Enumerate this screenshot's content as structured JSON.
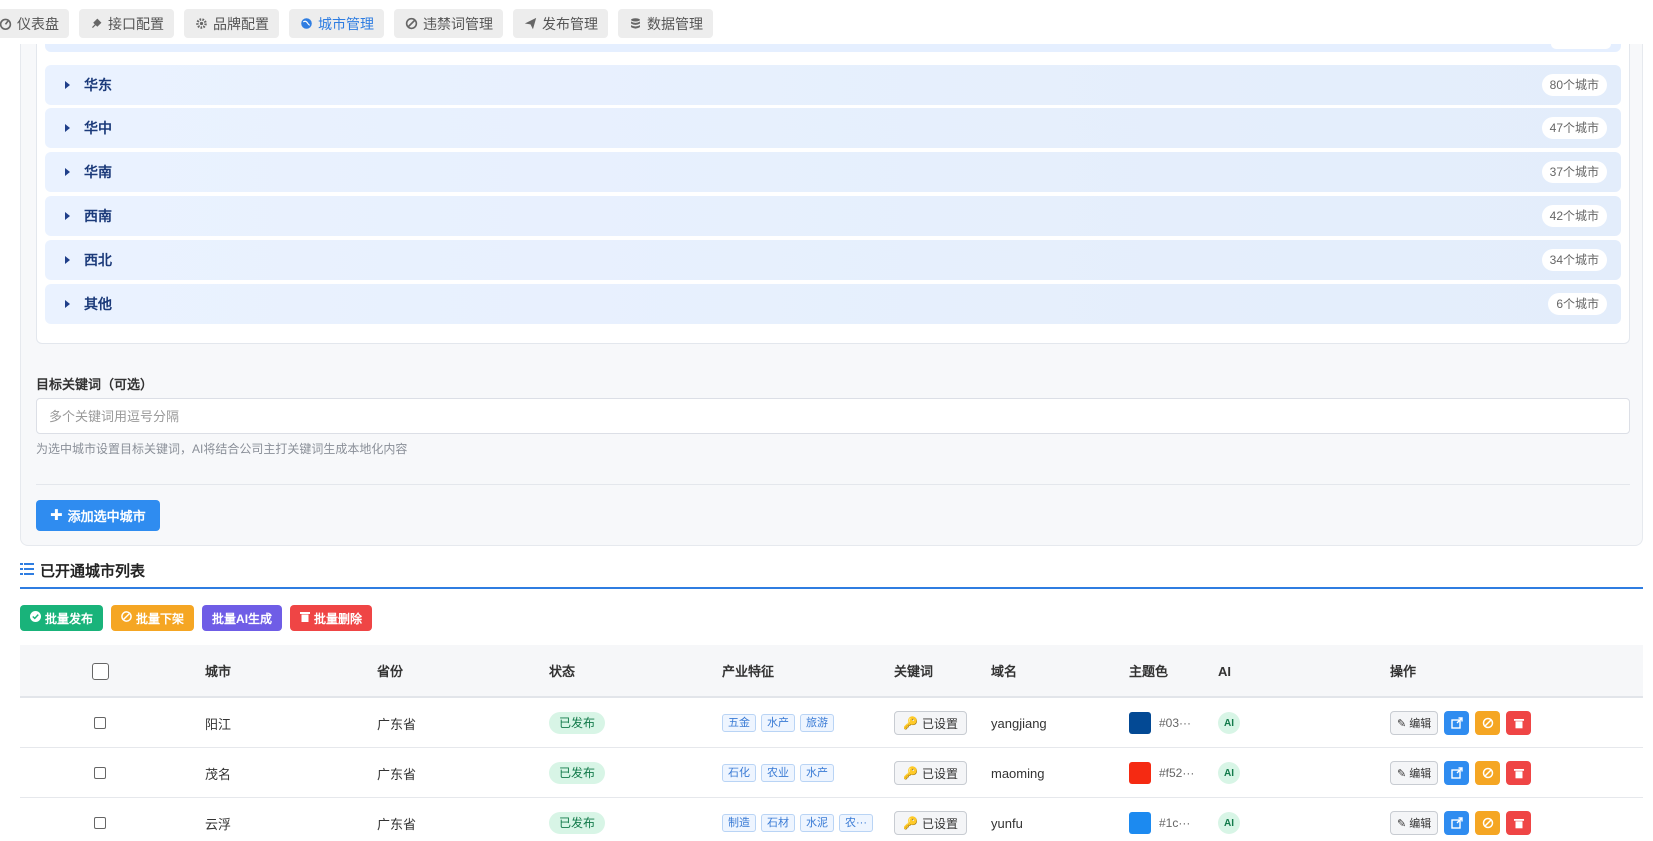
{
  "nav": {
    "tabs": [
      {
        "label": "仪表盘",
        "icon": "dashboard-icon",
        "active": false
      },
      {
        "label": "接口配置",
        "icon": "plug-icon",
        "active": false
      },
      {
        "label": "品牌配置",
        "icon": "gear-icon",
        "active": false
      },
      {
        "label": "城市管理",
        "icon": "globe-icon",
        "active": true
      },
      {
        "label": "违禁词管理",
        "icon": "ban-icon",
        "active": false
      },
      {
        "label": "发布管理",
        "icon": "paper-plane-icon",
        "active": false
      },
      {
        "label": "数据管理",
        "icon": "database-icon",
        "active": false
      }
    ]
  },
  "regions": [
    {
      "name": "华东",
      "count": "80个城市"
    },
    {
      "name": "华中",
      "count": "47个城市"
    },
    {
      "name": "华南",
      "count": "37个城市"
    },
    {
      "name": "西南",
      "count": "42个城市"
    },
    {
      "name": "西北",
      "count": "34个城市"
    },
    {
      "name": "其他",
      "count": "6个城市"
    }
  ],
  "keyword": {
    "label": "目标关键词（可选）",
    "placeholder": "多个关键词用逗号分隔",
    "value": "",
    "hint": "为选中城市设置目标关键词，AI将结合公司主打关键词生成本地化内容"
  },
  "add_button": "添加选中城市",
  "list": {
    "title": "已开通城市列表",
    "batch": {
      "publish": "批量发布",
      "unpublish": "批量下架",
      "ai_generate": "批量AI生成",
      "delete": "批量删除"
    },
    "columns": {
      "city": "城市",
      "province": "省份",
      "status": "状态",
      "industry": "产业特征",
      "keywords": "关键词",
      "domain": "域名",
      "theme": "主题色",
      "ai": "AI",
      "actions": "操作"
    },
    "rows": [
      {
        "city": "阳江",
        "province": "广东省",
        "status": "已发布",
        "tags": [
          "五金",
          "水产",
          "旅游"
        ],
        "keyword_btn": "已设置",
        "domain": "yangjiang",
        "color": "#034994",
        "color_text": "#03···",
        "ai": "AI",
        "edit": "编辑"
      },
      {
        "city": "茂名",
        "province": "广东省",
        "status": "已发布",
        "tags": [
          "石化",
          "农业",
          "水产"
        ],
        "keyword_btn": "已设置",
        "domain": "maoming",
        "color": "#f52a12",
        "color_text": "#f52···",
        "ai": "AI",
        "edit": "编辑"
      },
      {
        "city": "云浮",
        "province": "广东省",
        "status": "已发布",
        "tags": [
          "制造",
          "石材",
          "水泥",
          "农···"
        ],
        "keyword_btn": "已设置",
        "domain": "yunfu",
        "color": "#1c8af0",
        "color_text": "#1c···",
        "ai": "AI",
        "edit": "编辑"
      }
    ]
  }
}
